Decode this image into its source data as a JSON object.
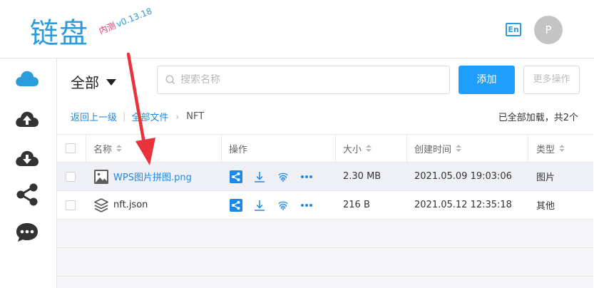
{
  "app": {
    "logo": "链盘",
    "version_tag": "内测",
    "version": "v0.13.18",
    "lang_button": "En",
    "avatar_letter": "P"
  },
  "colors": {
    "accent": "#1e9fff",
    "link": "#1e88e5",
    "brand": "#2d9cdb",
    "arrow": "#e8323c",
    "version_tag": "#e2336b"
  },
  "sidebar": {
    "items": [
      {
        "icon": "cloud-icon",
        "active": true
      },
      {
        "icon": "cloud-upload-icon"
      },
      {
        "icon": "cloud-download-icon"
      },
      {
        "icon": "share-icon"
      },
      {
        "icon": "chat-icon"
      }
    ]
  },
  "toolbar": {
    "scope": "全部",
    "search_placeholder": "搜索名称",
    "add_button": "添加",
    "more_button": "更多操作"
  },
  "breadcrumb": {
    "back": "返回上一级",
    "all_files": "全部文件",
    "current": "NFT",
    "status": "已全部加载，共2个"
  },
  "table": {
    "headers": {
      "name": "名称",
      "ops": "操作",
      "size": "大小",
      "created": "创建时间",
      "type": "类型"
    },
    "rows": [
      {
        "icon": "image-file-icon",
        "name": "WPS图片拼图.png",
        "size": "2.30 MB",
        "created": "2021.05.09 19:03:06",
        "type": "图片"
      },
      {
        "icon": "layers-file-icon",
        "name": "nft.json",
        "size": "216 B",
        "created": "2021.05.12 12:35:18",
        "type": "其他"
      }
    ]
  }
}
